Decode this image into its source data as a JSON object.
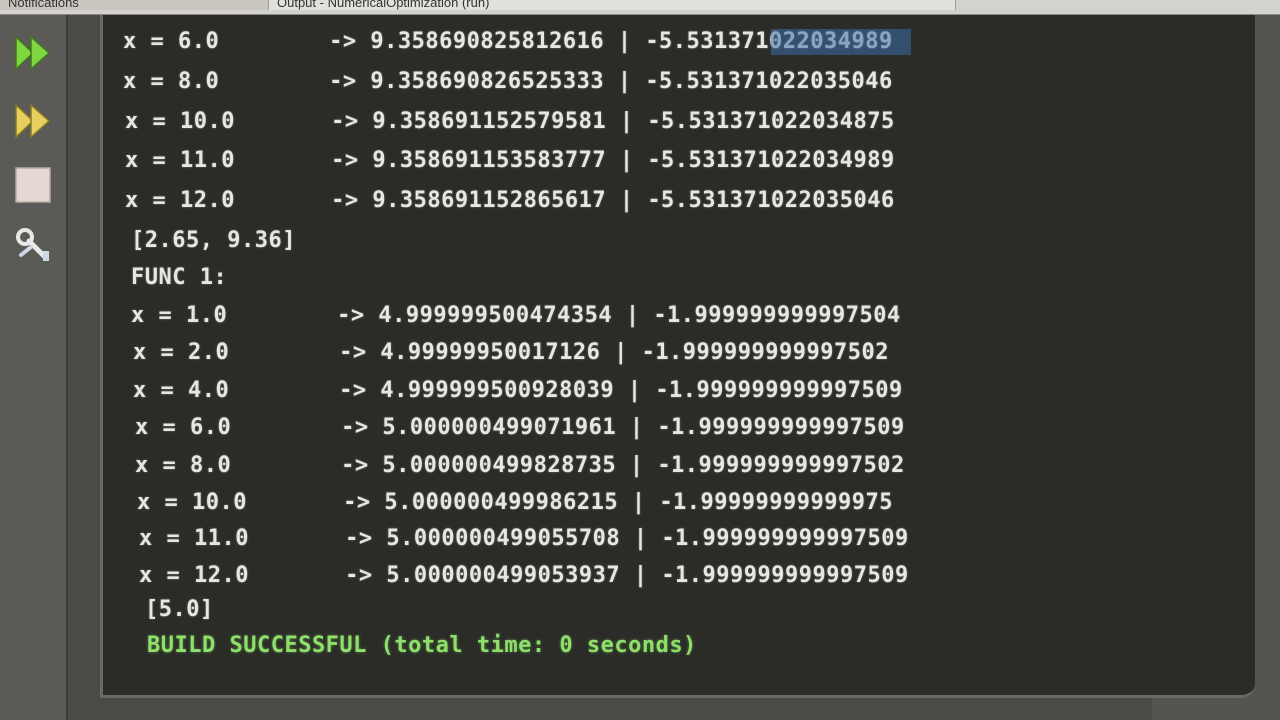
{
  "tabs": [
    {
      "label": "Notifications"
    },
    {
      "label": "Output - NumericalOptimization (run)"
    }
  ],
  "toolbar": {
    "rerun": "double-arrow-green-icon",
    "rerun_alt": "double-arrow-yellow-icon",
    "stop": "stop-square-icon",
    "settings": "wrench-settings-icon"
  },
  "output": {
    "lines": [
      {
        "text": "x = 6.0        -> 9.358690825812616 | -5.531371022034989",
        "highlight": "-5.531371"
      },
      {
        "text": "x = 8.0        -> 9.358690826525333 | -5.531371022035046"
      },
      {
        "text": "x = 10.0       -> 9.358691152579581 | -5.531371022034875"
      },
      {
        "text": "x = 11.0       -> 9.358691153583777 | -5.531371022034989"
      },
      {
        "text": "x = 12.0       -> 9.358691152865617 | -5.531371022035046"
      },
      {
        "text": "[2.65, 9.36]"
      },
      {
        "text": "FUNC 1:"
      },
      {
        "text": "x = 1.0        -> 4.999999500474354 | -1.999999999997504"
      },
      {
        "text": "x = 2.0        -> 4.99999950017126 | -1.999999999997502"
      },
      {
        "text": "x = 4.0        -> 4.999999500928039 | -1.999999999997509"
      },
      {
        "text": "x = 6.0        -> 5.000000499071961 | -1.999999999997509"
      },
      {
        "text": "x = 8.0        -> 5.000000499828735 | -1.999999999997502"
      },
      {
        "text": "x = 10.0       -> 5.000000499986215 | -1.99999999999975"
      },
      {
        "text": "x = 11.0       -> 5.000000499055708 | -1.999999999997509"
      },
      {
        "text": "x = 12.0       -> 5.000000499053937 | -1.999999999997509"
      },
      {
        "text": "[5.0]"
      }
    ],
    "build_status": "BUILD SUCCESSFUL (total time: 0 seconds)"
  },
  "colors": {
    "success": "#8ee06a",
    "selection": "#3d6ea8",
    "console_bg": "#2b2b28"
  }
}
